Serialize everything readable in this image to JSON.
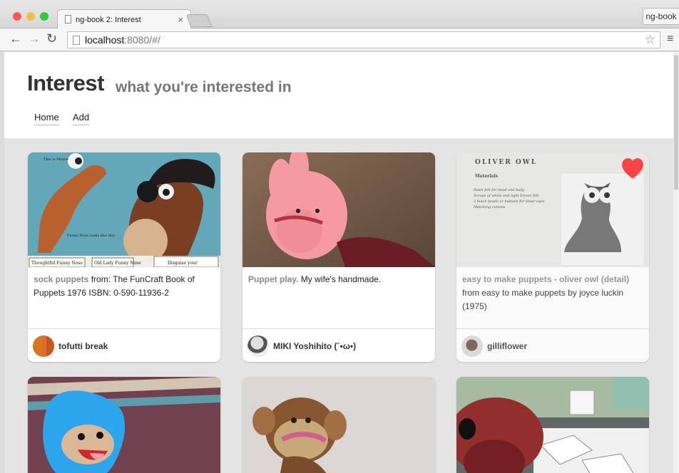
{
  "browser": {
    "tab_title": "ng-book 2: Interest",
    "tab_close": "×",
    "profile_label": "ng-book",
    "address_host": "localhost",
    "address_rest": ":8080/#/",
    "back_icon": "←",
    "forward_icon": "→",
    "reload_icon": "↻",
    "star_icon": "☆",
    "menu_icon": "≡"
  },
  "app": {
    "title": "Interest",
    "subtitle": "what you're interested in",
    "nav": [
      "Home",
      "Add"
    ]
  },
  "cards": [
    {
      "source": "sock puppets",
      "text": " from: The FunCraft Book of Puppets 1976 ISBN: 0-590-11936-2",
      "user": "tofutti break",
      "liked": false
    },
    {
      "source": "Puppet play.",
      "text": " My wife's handmade.",
      "user": "MIKI Yoshihito (´•ω•)",
      "liked": false
    },
    {
      "source": "easy to make puppets - oliver owl (detail)",
      "text": " from easy to make puppets by joyce luckin (1975)",
      "user": "gilliflower",
      "liked": true
    }
  ],
  "image_text": {
    "card3_heading": "OLIVER OWL",
    "card3_materials": "Materials",
    "card3_lines": [
      "Fawn felt for head and body",
      "Scraps of white and light brown felt",
      "2 black beads or buttons for inner eyes",
      "Matching cottons"
    ],
    "card1_labels": [
      "This is Monse",
      "Funny Nose looks like this",
      "Thoughtful Funny Nose",
      "Old Lady Funny Nose",
      "Disguise your"
    ]
  },
  "colors": {
    "heart": "#ff2020",
    "avatar1": "#d98226"
  }
}
